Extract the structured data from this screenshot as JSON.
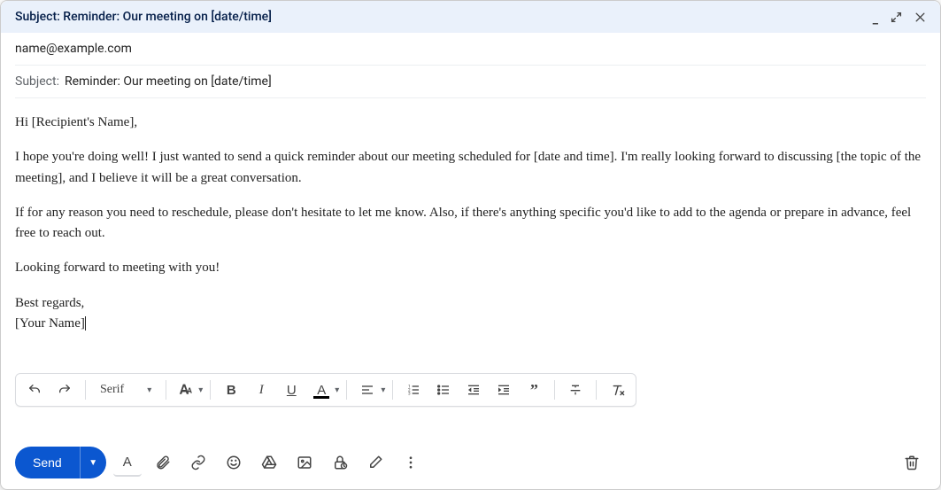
{
  "window": {
    "title": "Subject: Reminder: Our meeting on [date/time]"
  },
  "header": {
    "to": "name@example.com",
    "subject_label": "Subject:",
    "subject_value": "Reminder: Our meeting on [date/time]"
  },
  "body": {
    "greeting": "Hi [Recipient's Name],",
    "p1": "I hope you're doing well! I just wanted to send a quick reminder about our meeting scheduled for [date and time]. I'm really looking forward to discussing [the topic of the meeting], and I believe it will be a great conversation.",
    "p2": "If for any reason you need to reschedule, please don't hesitate to let me know. Also, if there's anything specific you'd like to add to the agenda or prepare in advance, feel free to reach out.",
    "p3": "Looking forward to meeting with you!",
    "signoff": "Best regards,",
    "name": "[Your Name]"
  },
  "toolbar": {
    "font": "Serif"
  },
  "actions": {
    "send": "Send"
  }
}
